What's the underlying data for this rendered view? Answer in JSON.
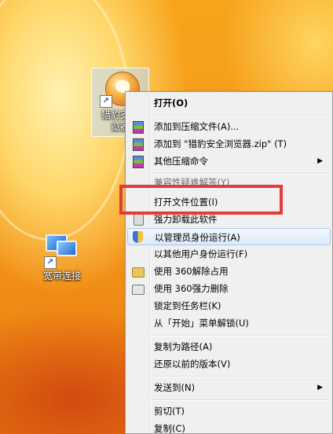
{
  "desktop": {
    "icons": [
      {
        "id": "browser",
        "label_line1": "猎豹安全",
        "label_line2": "览器"
      },
      {
        "id": "broadband",
        "label": "宽带连接"
      }
    ]
  },
  "context_menu": {
    "items": [
      {
        "label": "打开(O)",
        "bold": true
      },
      {
        "label": "添加到压缩文件(A)..."
      },
      {
        "label": "添加到 \"猎豹安全浏览器.zip\" (T)"
      },
      {
        "label": "其他压缩命令",
        "submenu": true
      },
      {
        "label": "兼容性疑难解答(Y)"
      },
      {
        "label": "打开文件位置(I)"
      },
      {
        "label": "强力卸载此软件"
      },
      {
        "label": "以管理员身份运行(A)"
      },
      {
        "label": "以其他用户身份运行(F)"
      },
      {
        "label": "使用 360解除占用"
      },
      {
        "label": "使用 360强力删除"
      },
      {
        "label": "锁定到任务栏(K)"
      },
      {
        "label": "从「开始」菜单解锁(U)"
      },
      {
        "label": "复制为路径(A)"
      },
      {
        "label": "还原以前的版本(V)"
      },
      {
        "label": "发送到(N)",
        "submenu": true
      },
      {
        "label": "剪切(T)"
      },
      {
        "label": "复制(C)"
      }
    ],
    "submenu_arrow": "▶",
    "highlight_color": "#e63a3a"
  }
}
